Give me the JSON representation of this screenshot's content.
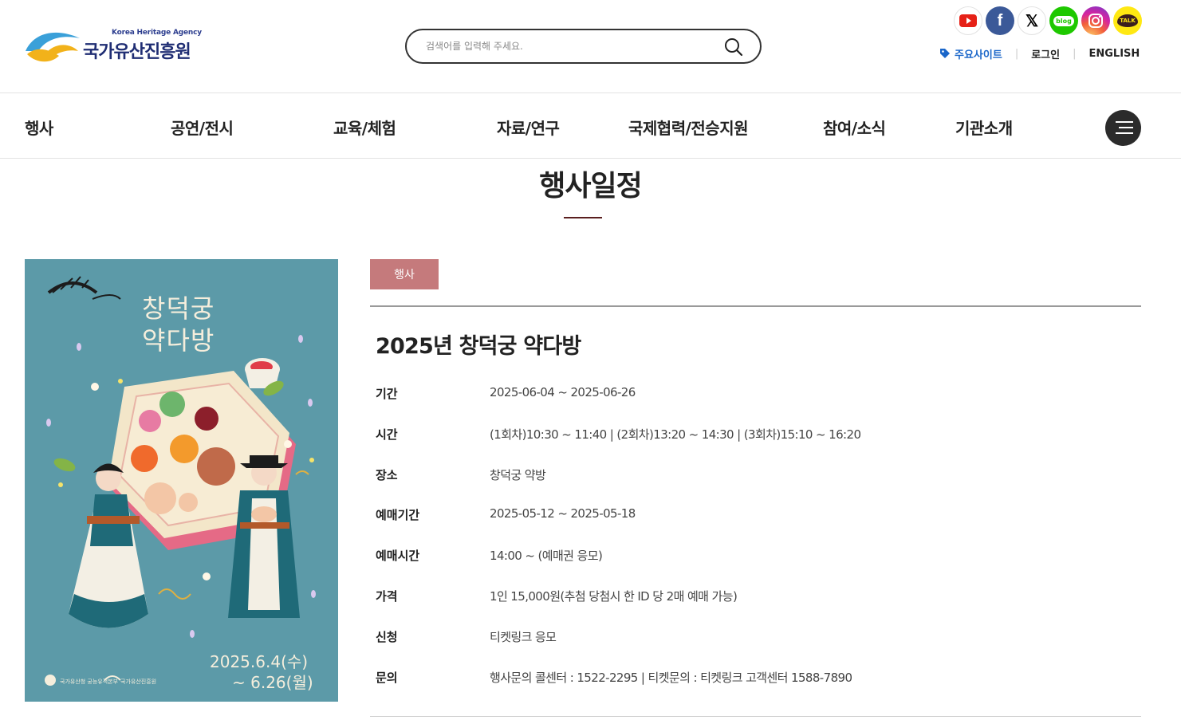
{
  "header": {
    "logo": {
      "subtitle": "Korea Heritage Agency",
      "name": "국가유산진흥원"
    },
    "search": {
      "placeholder": "검색어를 입력해 주세요."
    },
    "social": [
      {
        "name": "youtube-icon"
      },
      {
        "name": "facebook-icon",
        "glyph": "f"
      },
      {
        "name": "x-icon",
        "glyph": "𝕏"
      },
      {
        "name": "blog-icon",
        "glyph": "blog"
      },
      {
        "name": "instagram-icon"
      },
      {
        "name": "kakaotalk-icon",
        "glyph": "TALK"
      }
    ],
    "util": {
      "main_sites": "주요사이트",
      "login": "로그인",
      "english": "ENGLISH"
    }
  },
  "nav": {
    "items": [
      "행사",
      "공연/전시",
      "교육/체험",
      "자료/연구",
      "국제협력/전승지원",
      "참여/소식",
      "기관소개"
    ]
  },
  "page": {
    "title": "행사일정"
  },
  "poster": {
    "title_line1": "창덕궁",
    "title_line2": "약다방",
    "logo_text": "창덕궁 약다방",
    "date_line1": "2025.6.4(수)",
    "date_line2": "~ 6.26(월)",
    "org1": "국가유산청 궁능유적본부",
    "org2": "국가유산진흥원"
  },
  "event": {
    "category": "행사",
    "title": "2025년 창덕궁 약다방",
    "info": [
      {
        "label": "기간",
        "value": "2025-06-04 ~ 2025-06-26"
      },
      {
        "label": "시간",
        "value": "(1회차)10:30 ~ 11:40 | (2회차)13:20 ~ 14:30 | (3회차)15:10 ~ 16:20"
      },
      {
        "label": "장소",
        "value": "창덕궁 약방"
      },
      {
        "label": "예매기간",
        "value": "2025-05-12 ~ 2025-05-18"
      },
      {
        "label": "예매시간",
        "value": "14:00 ~ (예매권 응모)"
      },
      {
        "label": "가격",
        "value": "1인 15,000원(추첨 당첨시 한 ID 당 2매 예매 가능)"
      },
      {
        "label": "신청",
        "value": "티켓링크 응모"
      },
      {
        "label": "문의",
        "value": "행사문의 콜센터 : 1522-2295 | 티켓문의 : 티켓링크 고객센터 1588-7890"
      }
    ]
  },
  "colors": {
    "brand_navy": "#1f2d73",
    "accent_blue": "#1a66c9",
    "badge": "#c57a7c",
    "poster_bg": "#5c9aa8",
    "title_bar": "#5a1f1f"
  }
}
